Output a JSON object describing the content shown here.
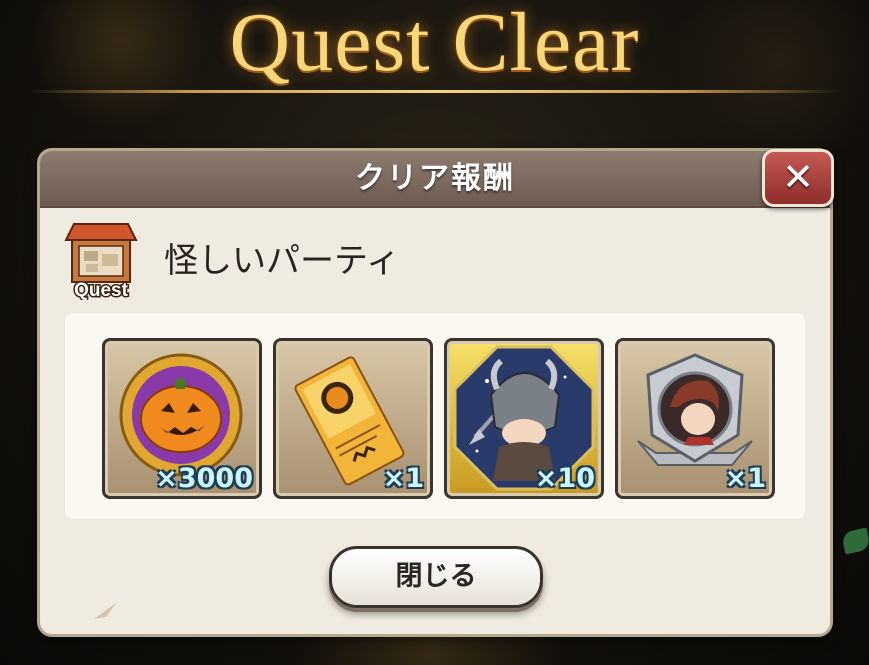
{
  "title": "Quest Clear",
  "panel": {
    "header": "クリア報酬",
    "close_icon": "close-x-icon",
    "quest_icon_label": "Quest",
    "quest_name": "怪しいパーティ"
  },
  "rewards": [
    {
      "item": "pumpkin-medal-icon",
      "quantity": "×3000"
    },
    {
      "item": "halloween-ticket-icon",
      "quantity": "×1"
    },
    {
      "item": "armored-knight-unit-icon",
      "quantity": "×10"
    },
    {
      "item": "character-emblem-icon",
      "quantity": "×1"
    }
  ],
  "close_button": "閉じる",
  "colors": {
    "title_gold": "#f7d77a",
    "header_bg": "#7d6b60",
    "panel_bg": "#f0ebe0",
    "close_red": "#a8403c",
    "quantity_text": "#c9f6ff"
  }
}
